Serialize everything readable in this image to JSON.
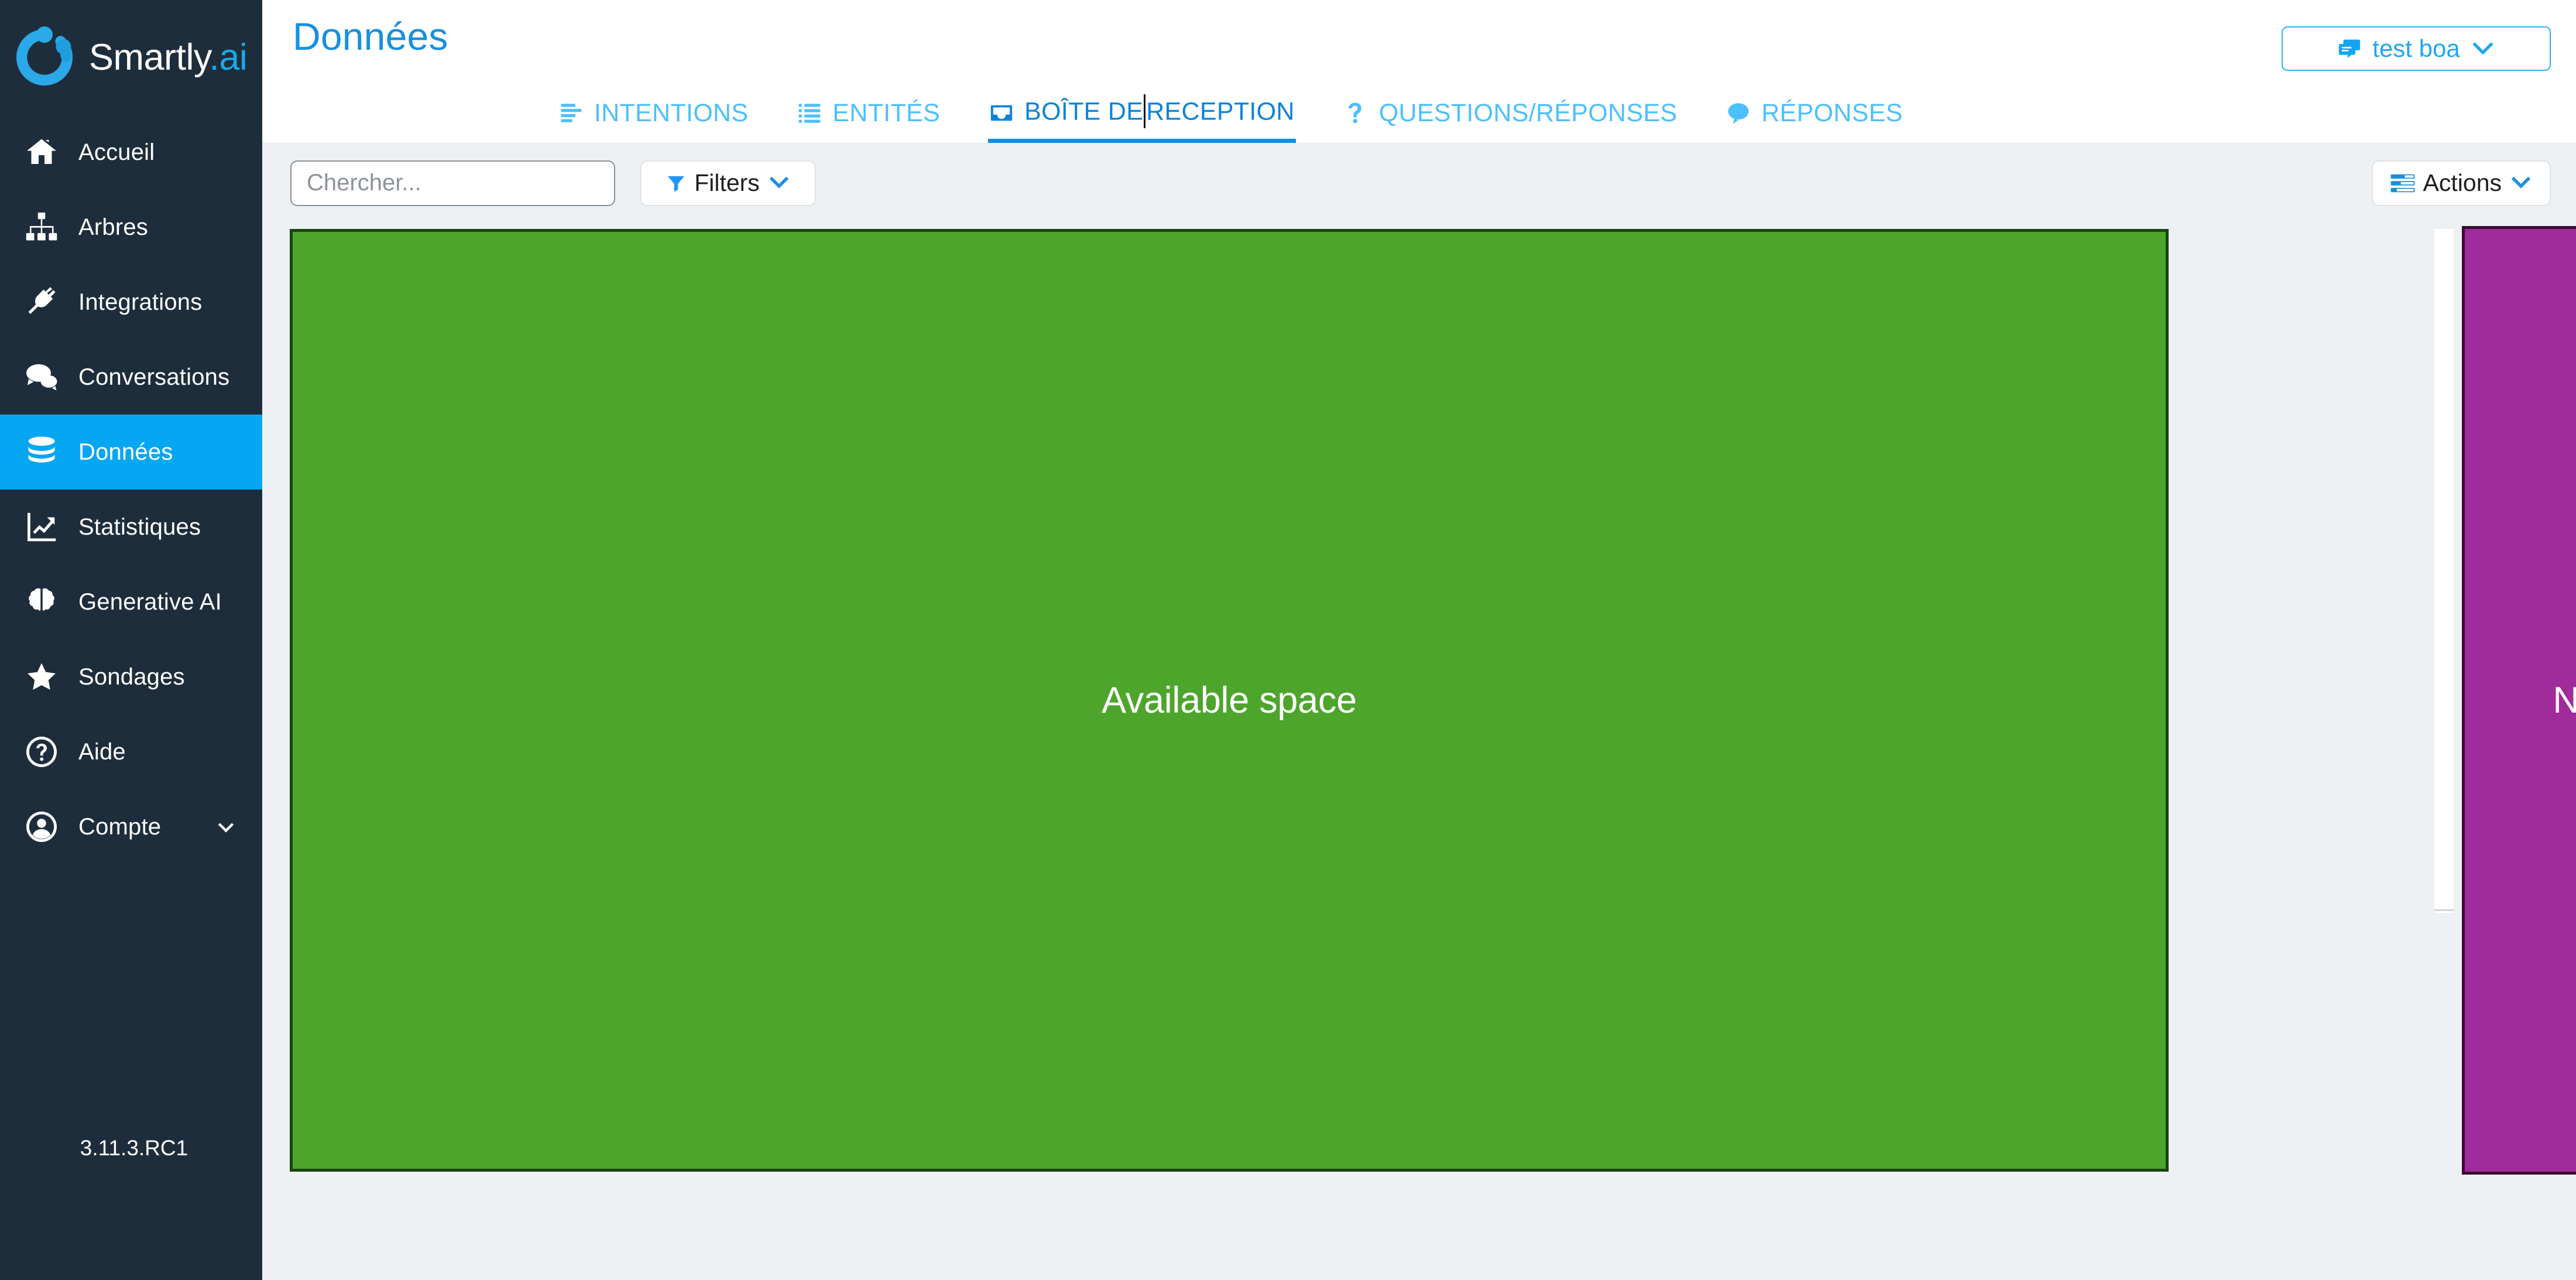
{
  "sidebar": {
    "brand": {
      "name": "Smartly",
      "suffix": ".ai",
      "logo_icon": "smartly-logo-icon"
    },
    "items": [
      {
        "label": "Accueil",
        "icon": "home-icon",
        "active": false
      },
      {
        "label": "Arbres",
        "icon": "sitemap-icon",
        "active": false
      },
      {
        "label": "Integrations",
        "icon": "plug-icon",
        "active": false
      },
      {
        "label": "Conversations",
        "icon": "chat-bubbles-icon",
        "active": false
      },
      {
        "label": "Données",
        "icon": "database-icon",
        "active": true
      },
      {
        "label": "Statistiques",
        "icon": "chart-line-icon",
        "active": false
      },
      {
        "label": "Generative AI",
        "icon": "brain-icon",
        "active": false
      },
      {
        "label": "Sondages",
        "icon": "star-icon",
        "active": false
      },
      {
        "label": "Aide",
        "icon": "question-circle-icon",
        "active": false
      },
      {
        "label": "Compte",
        "icon": "user-circle-icon",
        "active": false,
        "has_chevron": true
      }
    ],
    "version": "3.11.3.RC1",
    "active_color": "#06a7f2",
    "background_color": "#1e2d3b"
  },
  "header": {
    "title": "Données",
    "title_color": "#1790e0",
    "bot_selector": {
      "label": "test boa",
      "icon": "chat-stack-icon",
      "chevron_icon": "chevron-down-icon",
      "border_color": "#2ab4f7"
    }
  },
  "tabs": [
    {
      "label": "INTENTIONS",
      "icon": "align-left-icon",
      "active": false
    },
    {
      "label": "ENTITÉS",
      "icon": "list-icon",
      "active": false
    },
    {
      "label": "BOÎTE DE RECEPTION",
      "icon": "inbox-icon",
      "active": true,
      "label_before_caret": "BOÎTE DE",
      "label_after_caret": "RECEPTION"
    },
    {
      "label": "QUESTIONS/RÉPONSES",
      "icon": "question-mark-icon",
      "active": false
    },
    {
      "label": "RÉPONSES",
      "icon": "comment-icon",
      "active": false
    }
  ],
  "toolbar": {
    "search_placeholder": "Chercher...",
    "search_value": "",
    "filters": {
      "label": "Filters",
      "icon": "funnel-icon",
      "chevron_icon": "chevron-down-icon"
    },
    "actions": {
      "label": "Actions",
      "icon": "list-bars-icon",
      "chevron_icon": "chevron-down-icon"
    }
  },
  "content": {
    "available_panel": {
      "label": "Available space",
      "fill_color": "#4da52c",
      "border_color": "#1b4410",
      "text_color": "#ffffff"
    },
    "new_panel": {
      "label": "New space!",
      "fill_color": "#a02b9b",
      "border_color": "#3a0b33",
      "text_color": "#ffffff"
    },
    "scrollbar": {
      "name": "vertical-scrollbar"
    }
  }
}
